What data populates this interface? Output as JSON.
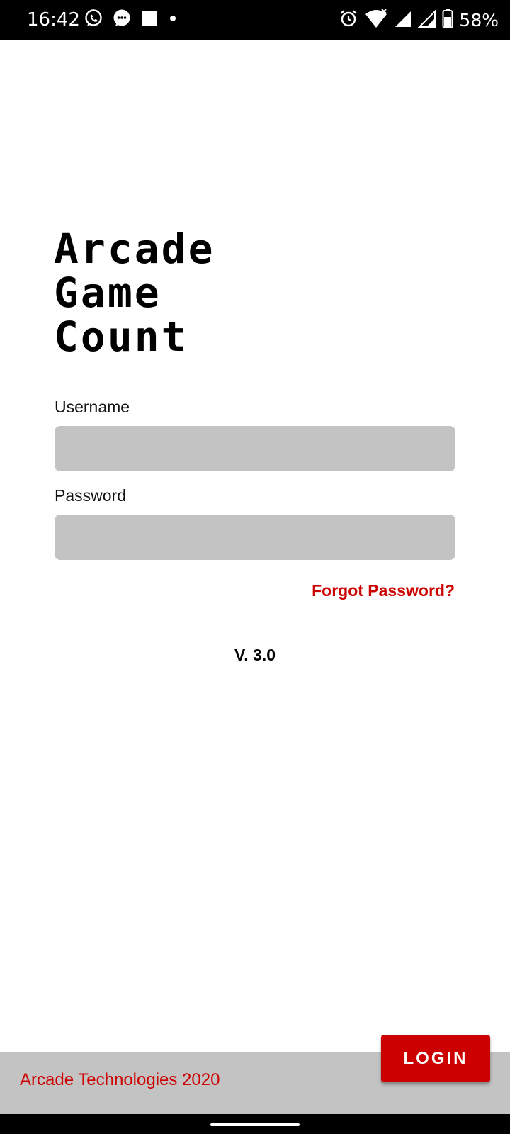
{
  "status_bar": {
    "time": "16:42",
    "battery_percent": "58%",
    "left_icons": [
      "whatsapp-icon",
      "messages-icon",
      "square-notification-icon",
      "dot-icon"
    ],
    "right_icons": [
      "alarm-icon",
      "wifi-icon",
      "signal-icon",
      "signal-icon",
      "battery-icon"
    ]
  },
  "app": {
    "title_lines": [
      "Arcade",
      "Game",
      "Count"
    ]
  },
  "form": {
    "username_label": "Username",
    "username_value": "",
    "password_label": "Password",
    "password_value": "",
    "forgot_password": "Forgot Password?"
  },
  "version": "V. 3.0",
  "footer": {
    "text": "Arcade Technologies 2020",
    "login_label": "LOGIN"
  },
  "colors": {
    "accent": "#cc0000",
    "field_background": "#c3c3c3",
    "footer_background": "#c3c3c3"
  }
}
